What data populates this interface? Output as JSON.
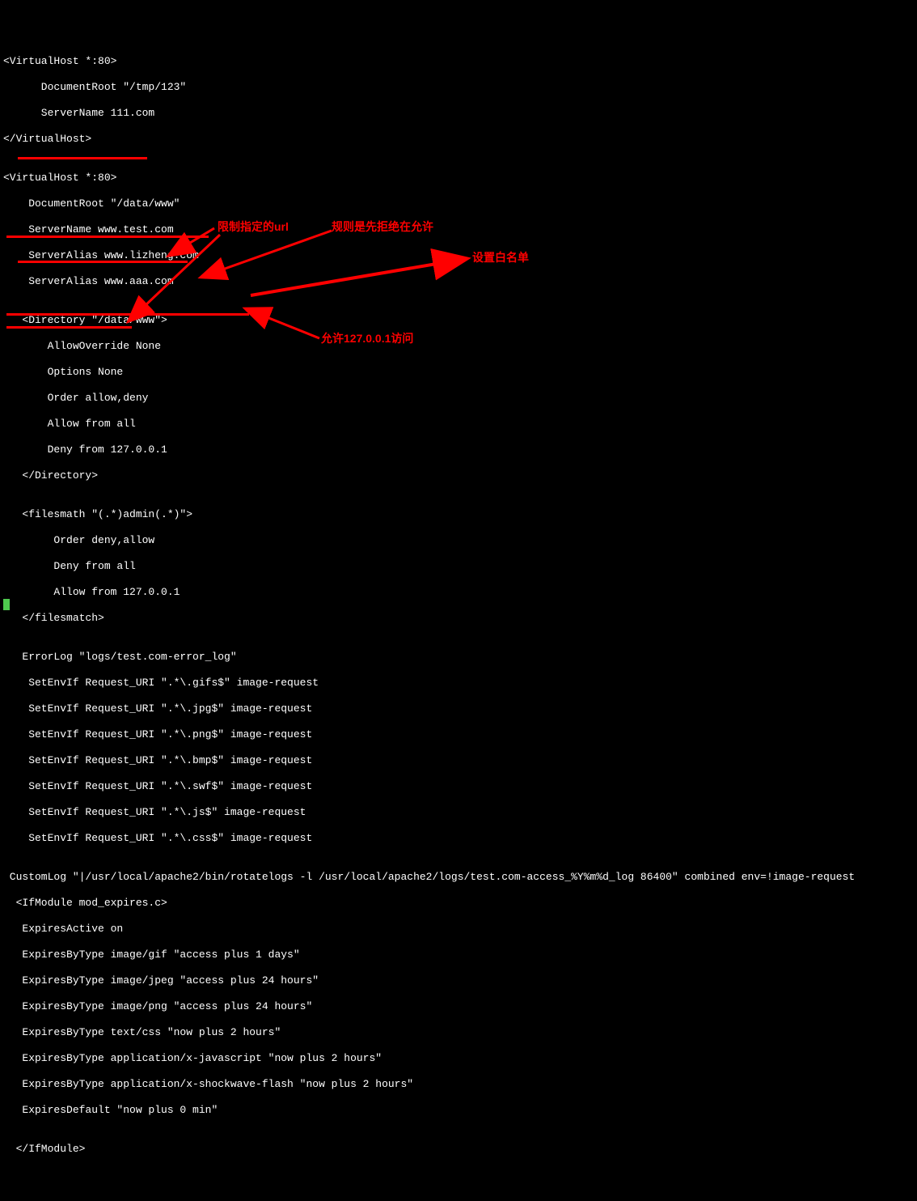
{
  "code": {
    "l1": "<VirtualHost *:80>",
    "l2": "      DocumentRoot \"/tmp/123\"",
    "l3": "      ServerName 111.com",
    "l4": "</VirtualHost>",
    "l5": "",
    "l6": "<VirtualHost *:80>",
    "l7": "    DocumentRoot \"/data/www\"",
    "l8": "    ServerName www.test.com",
    "l9": "    ServerAlias www.lizheng.com",
    "l10": "    ServerAlias www.aaa.com",
    "l11": "",
    "l12": "   <Directory \"/data/www\">",
    "l13": "       AllowOverride None",
    "l14": "       Options None",
    "l15": "       Order allow,deny",
    "l16": "       Allow from all",
    "l17": "       Deny from 127.0.0.1",
    "l18": "   </Directory>",
    "l19": "",
    "l20": "   <filesmath \"(.*)admin(.*)\">",
    "l21": "        Order deny,allow",
    "l22": "        Deny from all",
    "l23": "        Allow from 127.0.0.1",
    "l24": "   </filesmatch>",
    "l25": "",
    "l26": "   ErrorLog \"logs/test.com-error_log\"",
    "l27": "    SetEnvIf Request_URI \".*\\.gifs$\" image-request",
    "l28": "    SetEnvIf Request_URI \".*\\.jpg$\" image-request",
    "l29": "    SetEnvIf Request_URI \".*\\.png$\" image-request",
    "l30": "    SetEnvIf Request_URI \".*\\.bmp$\" image-request",
    "l31": "    SetEnvIf Request_URI \".*\\.swf$\" image-request",
    "l32": "    SetEnvIf Request_URI \".*\\.js$\" image-request",
    "l33": "    SetEnvIf Request_URI \".*\\.css$\" image-request",
    "l34": "",
    "l35": " CustomLog \"|/usr/local/apache2/bin/rotatelogs -l /usr/local/apache2/logs/test.com-access_%Y%m%d_log 86400\" combined env=!image-request",
    "l36": "  <IfModule mod_expires.c>",
    "l37": "   ExpiresActive on",
    "l38": "   ExpiresByType image/gif \"access plus 1 days\"",
    "l39": "   ExpiresByType image/jpeg \"access plus 24 hours\"",
    "l40": "   ExpiresByType image/png \"access plus 24 hours\"",
    "l41": "   ExpiresByType text/css \"now plus 2 hours\"",
    "l42": "   ExpiresByType application/x-javascript \"now plus 2 hours\"",
    "l43": "   ExpiresByType application/x-shockwave-flash \"now plus 2 hours\"",
    "l44": "   ExpiresDefault \"now plus 0 min\"",
    "l45": "",
    "l46": "  </IfModule>"
  },
  "annotations": {
    "a1": "限制指定的url",
    "a2": "规则是先拒绝在允许",
    "a3": "设置白名单",
    "a4": "允许127.0.0.1访问"
  }
}
